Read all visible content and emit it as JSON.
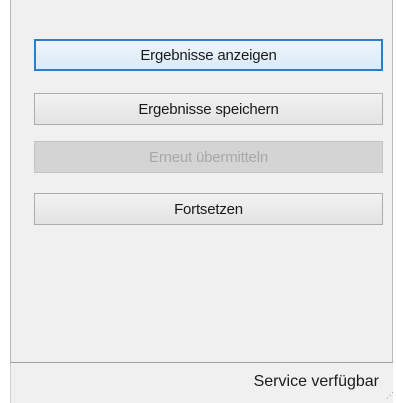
{
  "buttons": {
    "show_results": "Ergebnisse anzeigen",
    "save_results": "Ergebnisse speichern",
    "resubmit": "Erneut übermitteln",
    "continue": "Fortsetzen"
  },
  "statusbar": {
    "text": "Service verfügbar"
  }
}
